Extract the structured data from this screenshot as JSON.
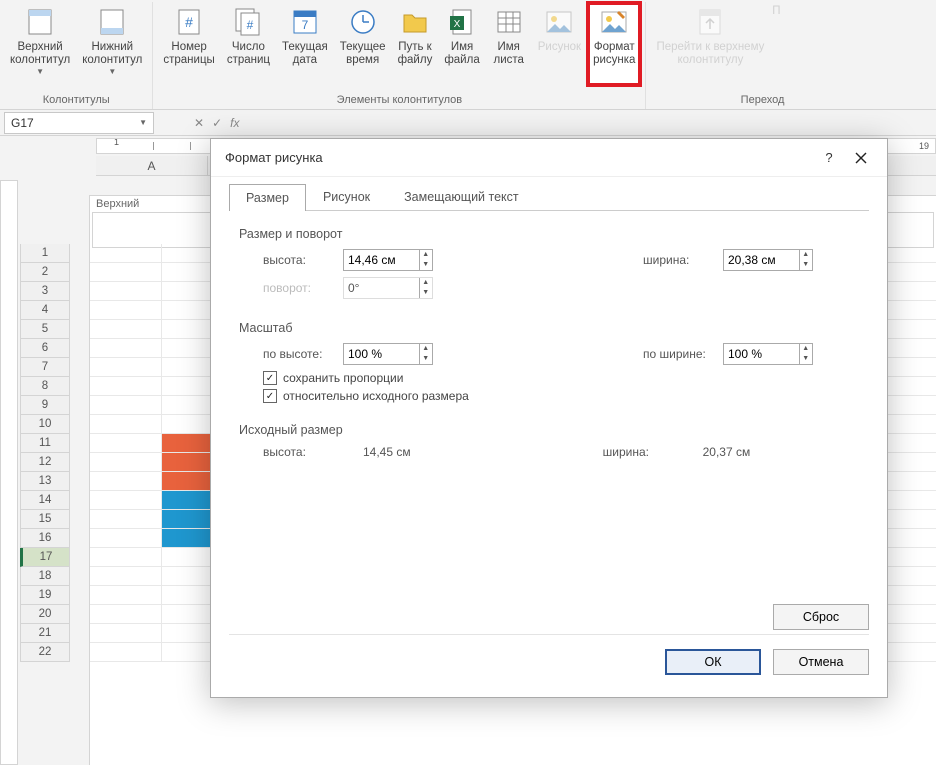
{
  "ribbon": {
    "groups": {
      "headers": {
        "label": "Колонтитулы",
        "header_btn": "Верхний\nколонтитул",
        "footer_btn": "Нижний\nколонтитул"
      },
      "elements": {
        "label": "Элементы колонтитулов",
        "page_number": "Номер\nстраницы",
        "page_count": "Число\nстраниц",
        "current_date": "Текущая\nдата",
        "current_time": "Текущее\nвремя",
        "file_path": "Путь к\nфайлу",
        "file_name": "Имя\nфайла",
        "sheet_name": "Имя\nлиста",
        "picture": "Рисунок",
        "format_picture": "Формат\nрисунка"
      },
      "navigation": {
        "label": "Переход",
        "goto_header": "Перейти к верхнему\nколонтитулу",
        "goto_footer": "П"
      }
    }
  },
  "name_box": "G17",
  "fx_label": "fx",
  "column_headers": [
    "A"
  ],
  "page_header_label": "Верхний",
  "row_numbers": [
    "1",
    "2",
    "3",
    "4",
    "5",
    "6",
    "7",
    "8",
    "9",
    "10",
    "11",
    "12",
    "13",
    "14",
    "15",
    "16",
    "17",
    "18",
    "19",
    "20",
    "21",
    "22"
  ],
  "selected_row": "17",
  "ruler_right": "19",
  "dialog": {
    "title": "Формат рисунка",
    "help_symbol": "?",
    "tabs": {
      "size": "Размер",
      "picture": "Рисунок",
      "alt_text": "Замещающий текст"
    },
    "sections": {
      "size_rotate": "Размер и поворот",
      "scale": "Масштаб",
      "original_size": "Исходный размер"
    },
    "labels": {
      "height": "высота:",
      "width": "ширина:",
      "rotation": "поворот:",
      "scale_height": "по высоте:",
      "scale_width": "по ширине:"
    },
    "values": {
      "height": "14,46 см",
      "width": "20,38 см",
      "rotation": "0°",
      "scale_h": "100 %",
      "scale_w": "100 %",
      "orig_height": "14,45 см",
      "orig_width": "20,37 см"
    },
    "checkboxes": {
      "lock_aspect": "сохранить пропорции",
      "relative_original": "относительно исходного размера"
    },
    "buttons": {
      "reset": "Сброс",
      "ok": "ОК",
      "cancel": "Отмена"
    }
  }
}
